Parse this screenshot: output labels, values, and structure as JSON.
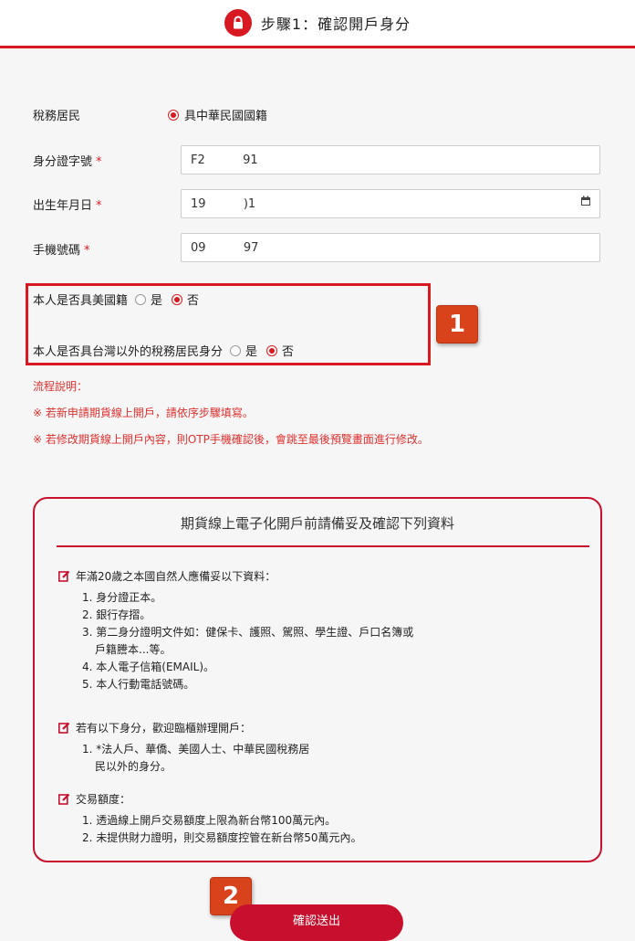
{
  "header": {
    "title": "步驟1：確認開戶身分",
    "icon": "lock-icon"
  },
  "form": {
    "tax_residency": {
      "label": "稅務居民",
      "option": "具中華民國國籍"
    },
    "id_number": {
      "label": "身分證字號",
      "required_mark": "*",
      "value": "F2          91"
    },
    "birthday": {
      "label": "出生年月日",
      "required_mark": "*",
      "value": "19          )1"
    },
    "mobile": {
      "label": "手機號碼",
      "required_mark": "*",
      "value": "09          97"
    },
    "q_us": {
      "text": "本人是否具美國籍",
      "yes": "是",
      "no": "否",
      "selected": "no"
    },
    "q_tax_other": {
      "text": "本人是否具台灣以外的稅務居民身分",
      "yes": "是",
      "no": "否",
      "selected": "no"
    }
  },
  "annotations": {
    "badge1": "1",
    "badge2": "2"
  },
  "process_notes": {
    "title": "流程說明：",
    "note1": "※ 若新申請期貨線上開戶，請依序步驟填寫。",
    "note2": "※ 若修改期貨線上開戶內容，則OTP手機確認後，會跳至最後預覽畫面進行修改。"
  },
  "panel": {
    "title": "期貨線上電子化開戶前請備妥及確認下列資料",
    "section1": {
      "heading": "年滿20歲之本國自然人應備妥以下資料：",
      "items": [
        "1. 身分證正本。",
        "2. 銀行存摺。",
        "3. 第二身分證明文件如：健保卡、護照、駕照、學生證、戶口名簿或",
        "戶籍謄本...等。",
        "4. 本人電子信箱(EMAIL)。",
        "5. 本人行動電話號碼。"
      ]
    },
    "section2": {
      "heading": "若有以下身分，歡迎臨櫃辦理開戶：",
      "items": [
        "1. *法人戶、華僑、美國人士、中華民國稅務居",
        "民以外的身分。"
      ]
    },
    "section3": {
      "heading": "交易額度：",
      "items": [
        "1. 透過線上開戶交易額度上限為新台幣100萬元內。",
        "2. 未提供財力證明，則交易額度控管在新台幣50萬元內。"
      ]
    }
  },
  "submit": {
    "label": "確認送出"
  },
  "colors": {
    "brand_red": "#d81921",
    "badge_orange": "#d9431b",
    "note_red": "#e0302f"
  }
}
